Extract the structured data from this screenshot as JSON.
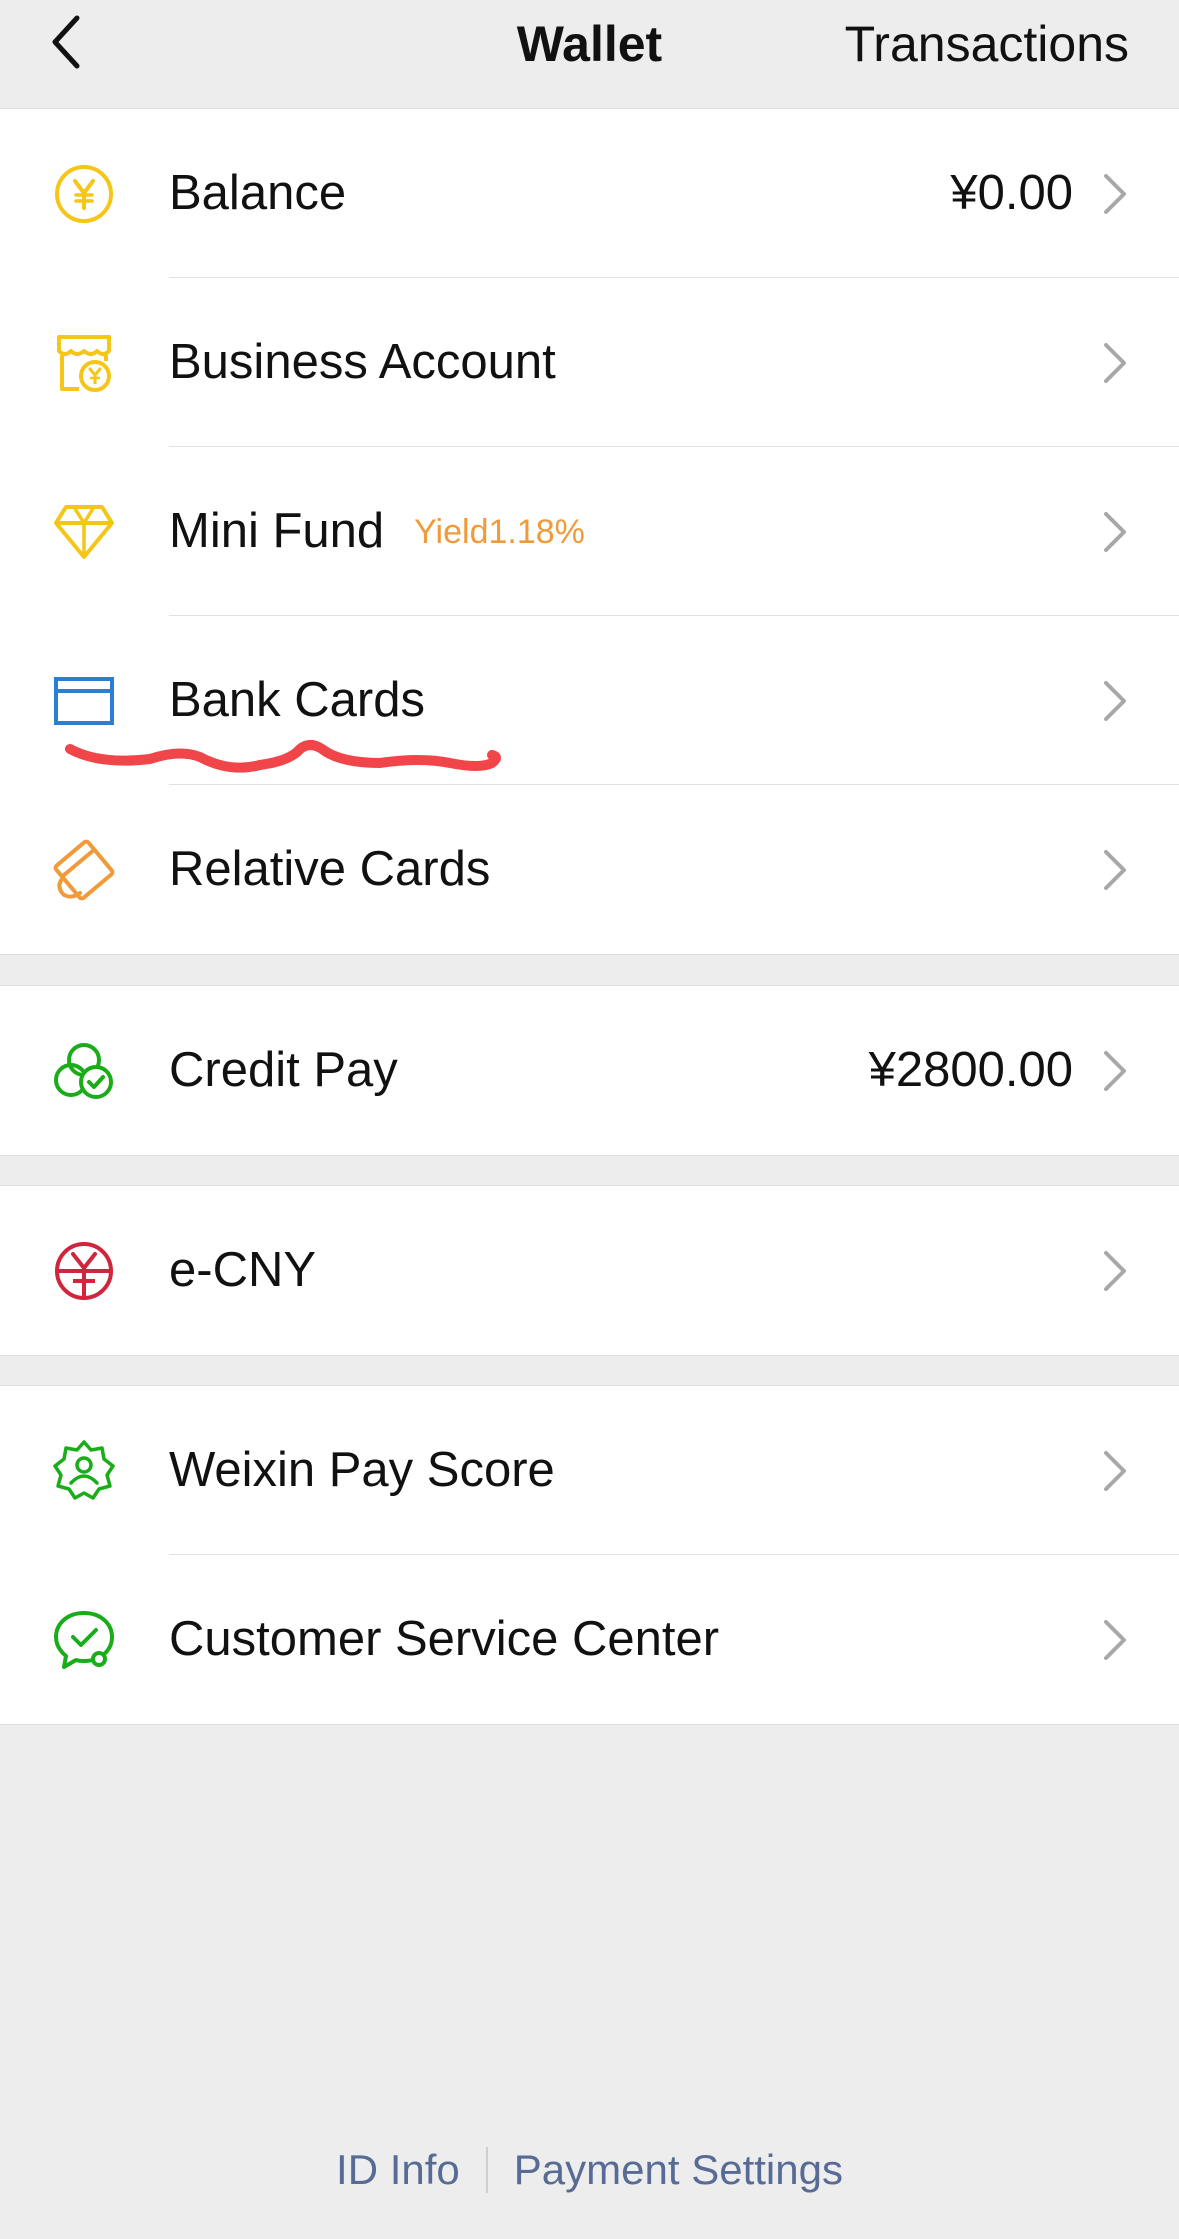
{
  "header": {
    "title": "Wallet",
    "back_icon": "chevron-left-icon",
    "transactions_label": "Transactions"
  },
  "groups": [
    {
      "items": [
        {
          "label": "Balance",
          "value": "¥0.00",
          "icon": "yuan-coin-icon",
          "color": "#f5c518"
        },
        {
          "label": "Business Account",
          "icon": "shop-icon",
          "color": "#f5c518"
        },
        {
          "label": "Mini Fund",
          "badge": "Yield1.18%",
          "icon": "diamond-icon",
          "color": "#f5c518"
        },
        {
          "label": "Bank Cards",
          "icon": "bank-card-icon",
          "color": "#2b7fd3"
        },
        {
          "label": "Relative Cards",
          "icon": "relative-card-icon",
          "color": "#f09a3a"
        }
      ]
    },
    {
      "items": [
        {
          "label": "Credit Pay",
          "value": "¥2800.00",
          "icon": "credit-pay-icon",
          "color": "#1aad19"
        }
      ]
    },
    {
      "items": [
        {
          "label": "e-CNY",
          "icon": "ecny-icon",
          "color": "#d0253c"
        }
      ]
    },
    {
      "items": [
        {
          "label": "Weixin Pay Score",
          "icon": "pay-score-icon",
          "color": "#1aad19"
        },
        {
          "label": "Customer Service Center",
          "icon": "customer-service-icon",
          "color": "#1aad19"
        }
      ]
    }
  ],
  "annotation": {
    "color": "#f0464a"
  },
  "footer": {
    "id_info_label": "ID Info",
    "payment_settings_label": "Payment Settings",
    "link_color": "#576b95"
  }
}
